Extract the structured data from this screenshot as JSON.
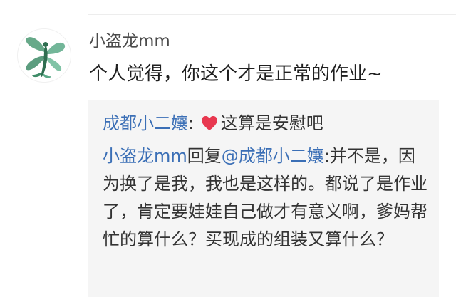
{
  "comment": {
    "username": "小盗龙mm",
    "text": "个人觉得，你这个才是正常的作业~"
  },
  "replies": [
    {
      "author": "成都小二孃",
      "separator": ":",
      "emoji": "heart-icon",
      "text": "这算是安慰吧"
    },
    {
      "author": "小盗龙mm",
      "reply_word": "回复",
      "mention": "@成都小二孃",
      "separator": ":",
      "text": "并不是，因为换了是我，我也是这样的。都说了是作业了，肯定要娃娃自己做才有意义啊，爹妈帮忙的算什么？买现成的组装又算什么？"
    }
  ],
  "colors": {
    "link": "#3b6fb6",
    "heart": "#e8384f",
    "reply_bg": "#f5f5f5"
  }
}
